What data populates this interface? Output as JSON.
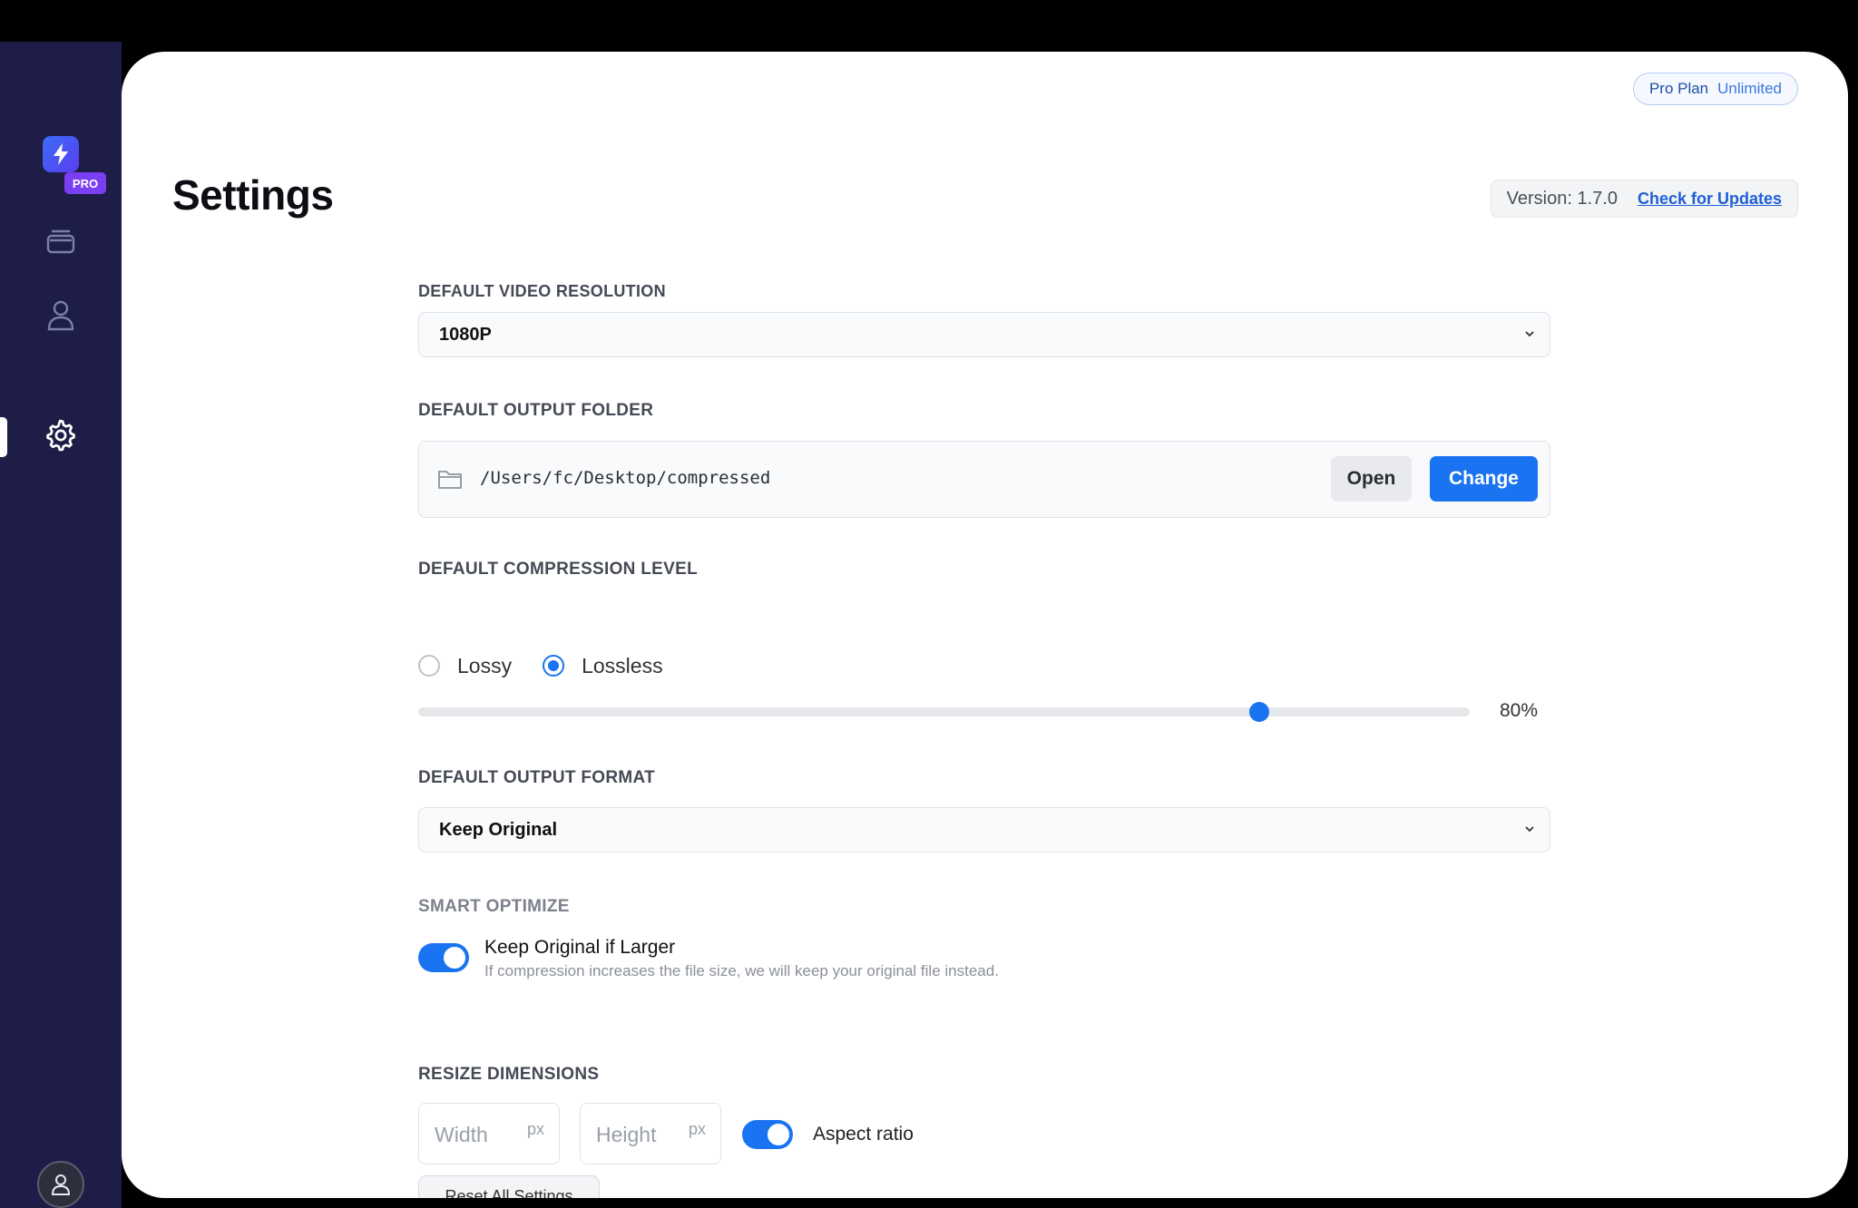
{
  "sidebar": {
    "logo_icon": "lightning-bolt-icon",
    "pro_badge": "PRO",
    "nav_items": [
      {
        "icon": "layers-icon",
        "name": "library"
      },
      {
        "icon": "user-icon",
        "name": "account"
      },
      {
        "icon": "gear-icon",
        "name": "settings",
        "active": true
      }
    ],
    "avatar_icon": "user-icon"
  },
  "header": {
    "plan": "Pro Plan",
    "plan_sub": "Unlimited",
    "title": "Settings",
    "version": "Version: 1.7.0",
    "check_updates": "Check for Updates"
  },
  "settings": {
    "video_resolution": {
      "label": "DEFAULT VIDEO RESOLUTION",
      "value": "1080P"
    },
    "output_folder": {
      "label": "DEFAULT OUTPUT FOLDER",
      "path": "/Users/fc/Desktop/compressed",
      "open_label": "Open",
      "change_label": "Change"
    },
    "compression": {
      "label": "DEFAULT COMPRESSION LEVEL",
      "option_lossy": "Lossy",
      "option_lossless": "Lossless",
      "selected": "Lossless",
      "level_fraction": 0.8,
      "level_text": "80%"
    },
    "output_format": {
      "label": "DEFAULT OUTPUT FORMAT",
      "value": "Keep Original"
    },
    "smart_optimize": {
      "label": "SMART OPTIMIZE",
      "option_title": "Keep Original if Larger",
      "option_desc": "If compression increases the file size, we will keep your original file instead.",
      "enabled": true
    },
    "resize": {
      "label": "RESIZE DIMENSIONS",
      "width_placeholder": "Width",
      "height_placeholder": "Height",
      "unit": "px",
      "aspect_label": "Aspect ratio",
      "aspect_enabled": true
    },
    "reset_label": "Reset All Settings"
  },
  "colors": {
    "accent": "#1a73f0",
    "sidebar": "#1e1d48",
    "pro_badge": "#7a3ff2"
  }
}
